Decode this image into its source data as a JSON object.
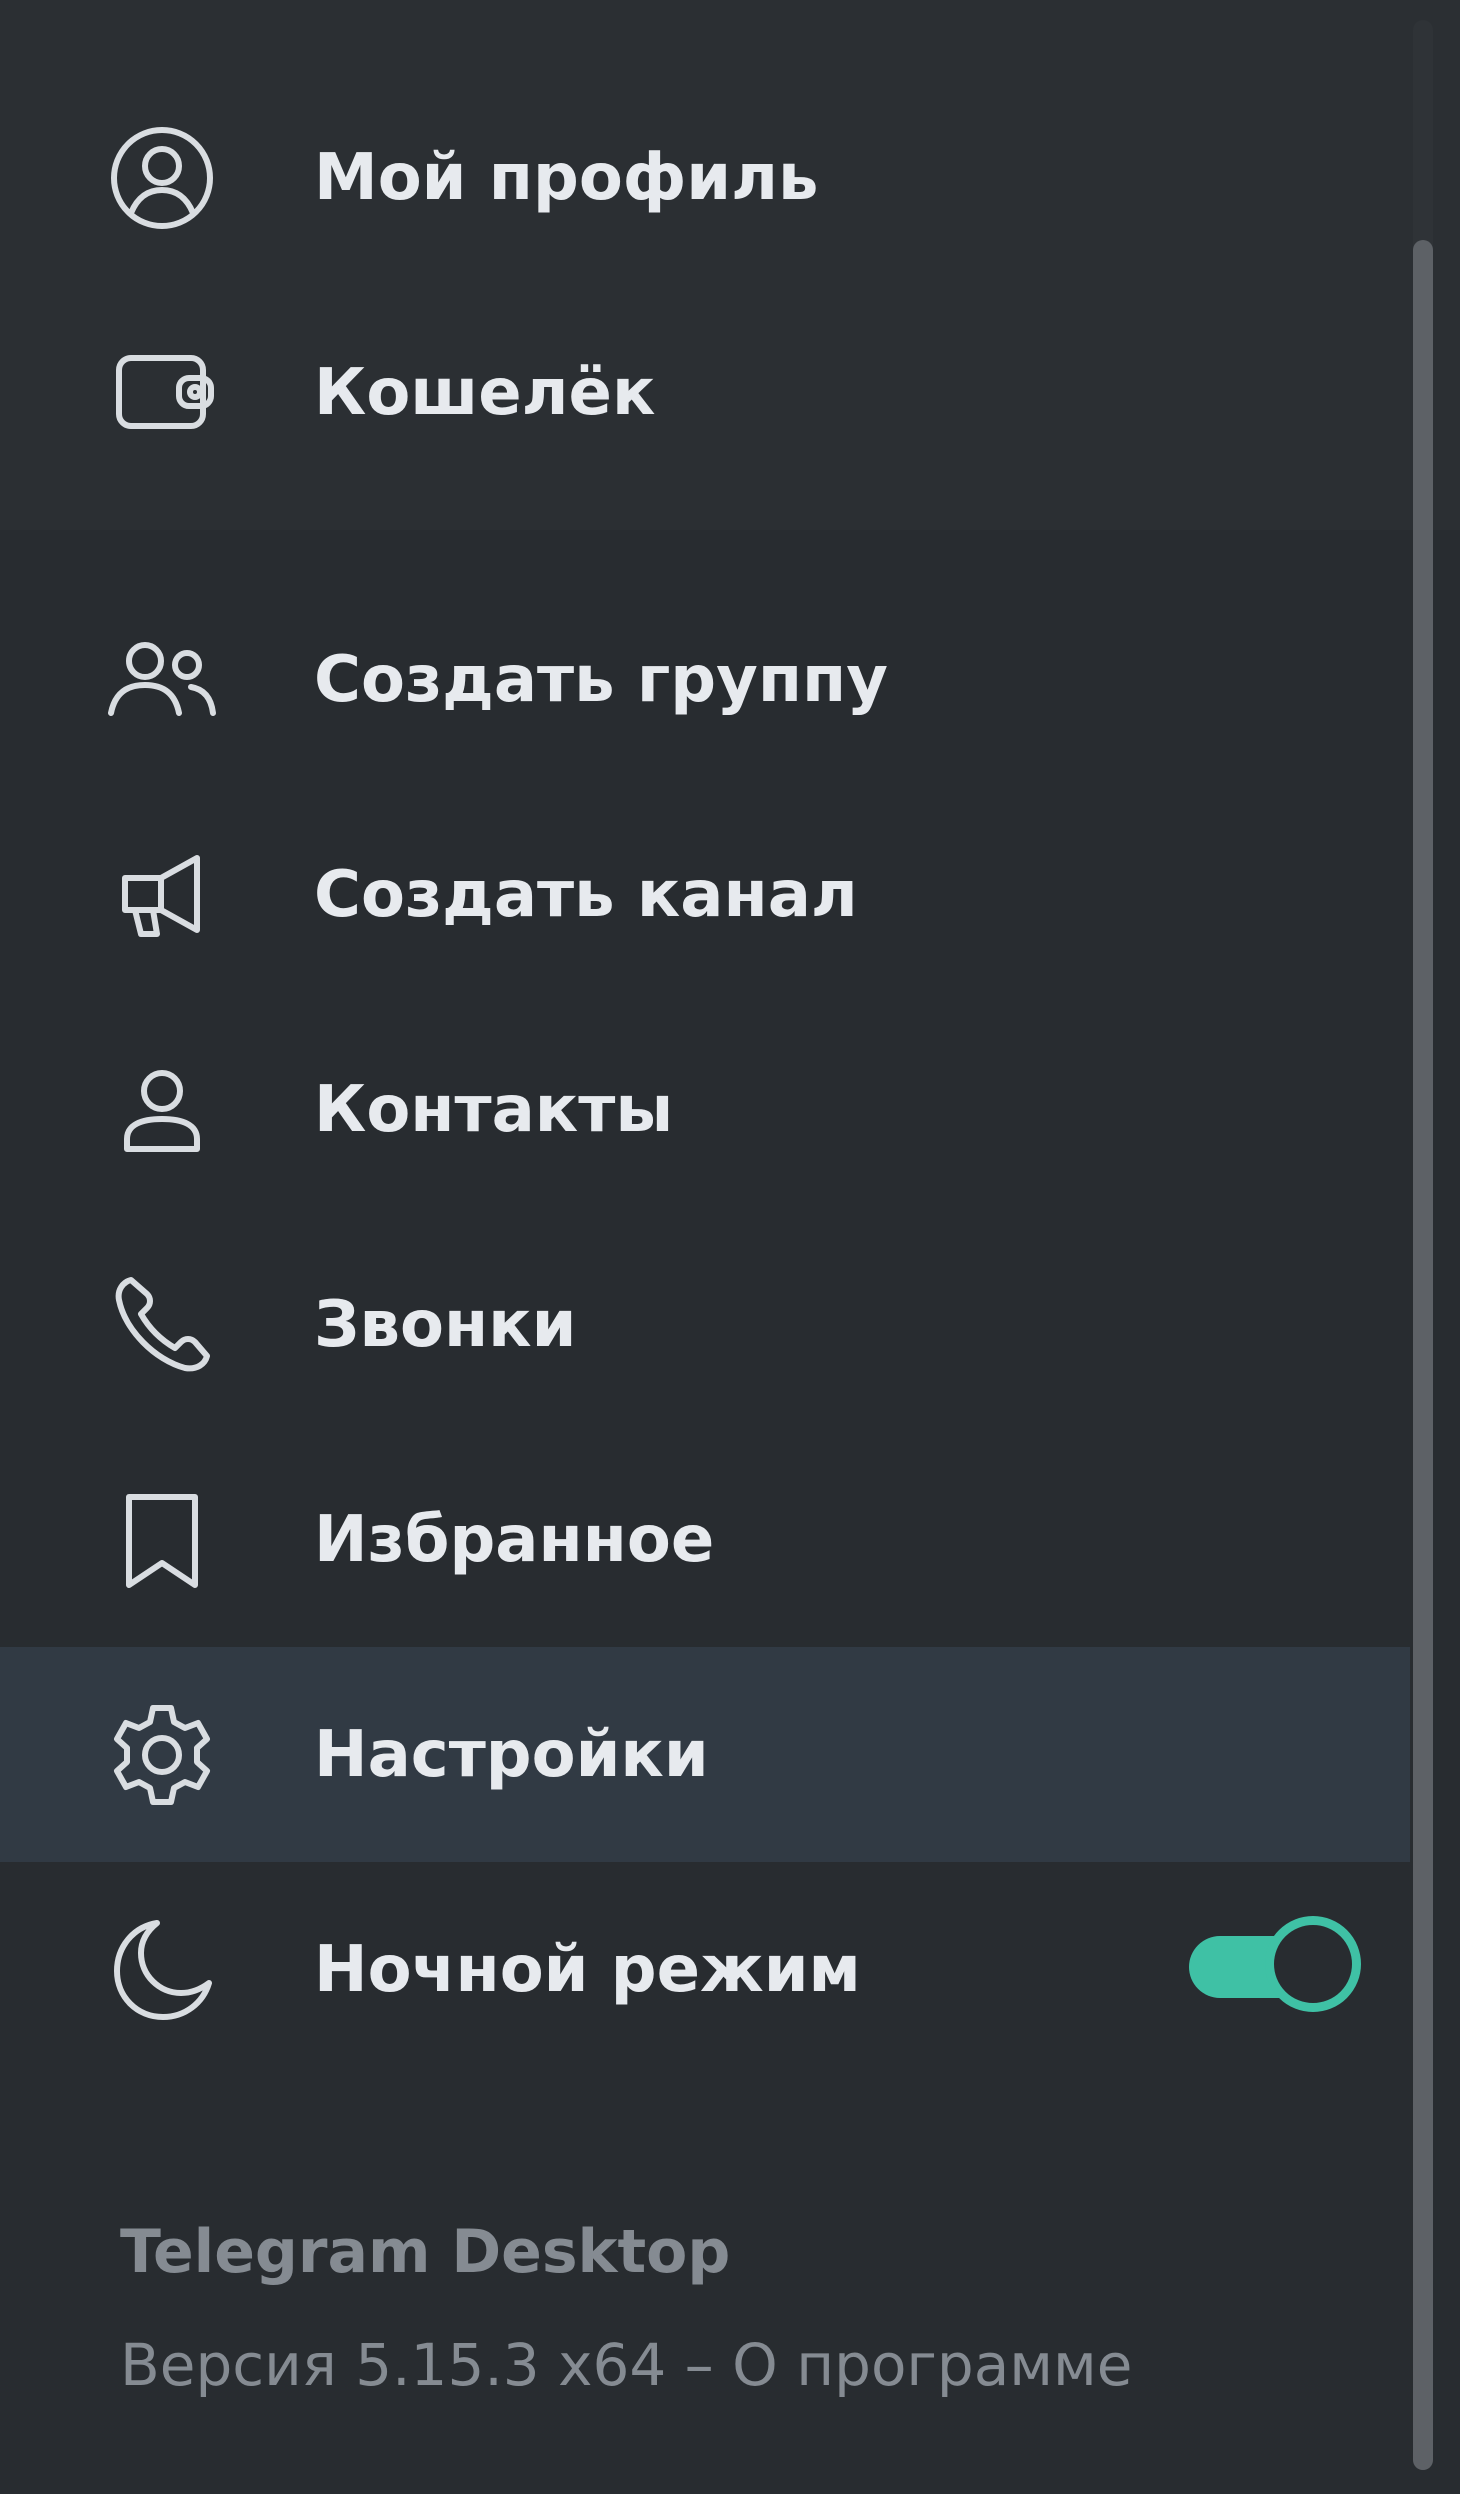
{
  "menu": {
    "items": [
      {
        "label": "Мой профиль",
        "icon": "profile-icon"
      },
      {
        "label": "Кошелёк",
        "icon": "wallet-icon"
      },
      {
        "label": "Создать группу",
        "icon": "group-icon"
      },
      {
        "label": "Создать канал",
        "icon": "megaphone-icon"
      },
      {
        "label": "Контакты",
        "icon": "contact-icon"
      },
      {
        "label": "Звонки",
        "icon": "phone-icon"
      },
      {
        "label": "Избранное",
        "icon": "bookmark-icon"
      },
      {
        "label": "Настройки",
        "icon": "gear-icon",
        "highlighted": true
      },
      {
        "label": "Ночной режим",
        "icon": "moon-icon",
        "toggle": true
      }
    ],
    "night_mode_enabled": true
  },
  "footer": {
    "app_name": "Telegram Desktop",
    "version": "Версия 5.15.3 x64",
    "separator": " – ",
    "about_link": "О программе"
  },
  "colors": {
    "background": "#282c30",
    "highlight": "#313a44",
    "accent": "#3fc1a5",
    "text": "#e7eaee",
    "muted": "#858b92"
  }
}
